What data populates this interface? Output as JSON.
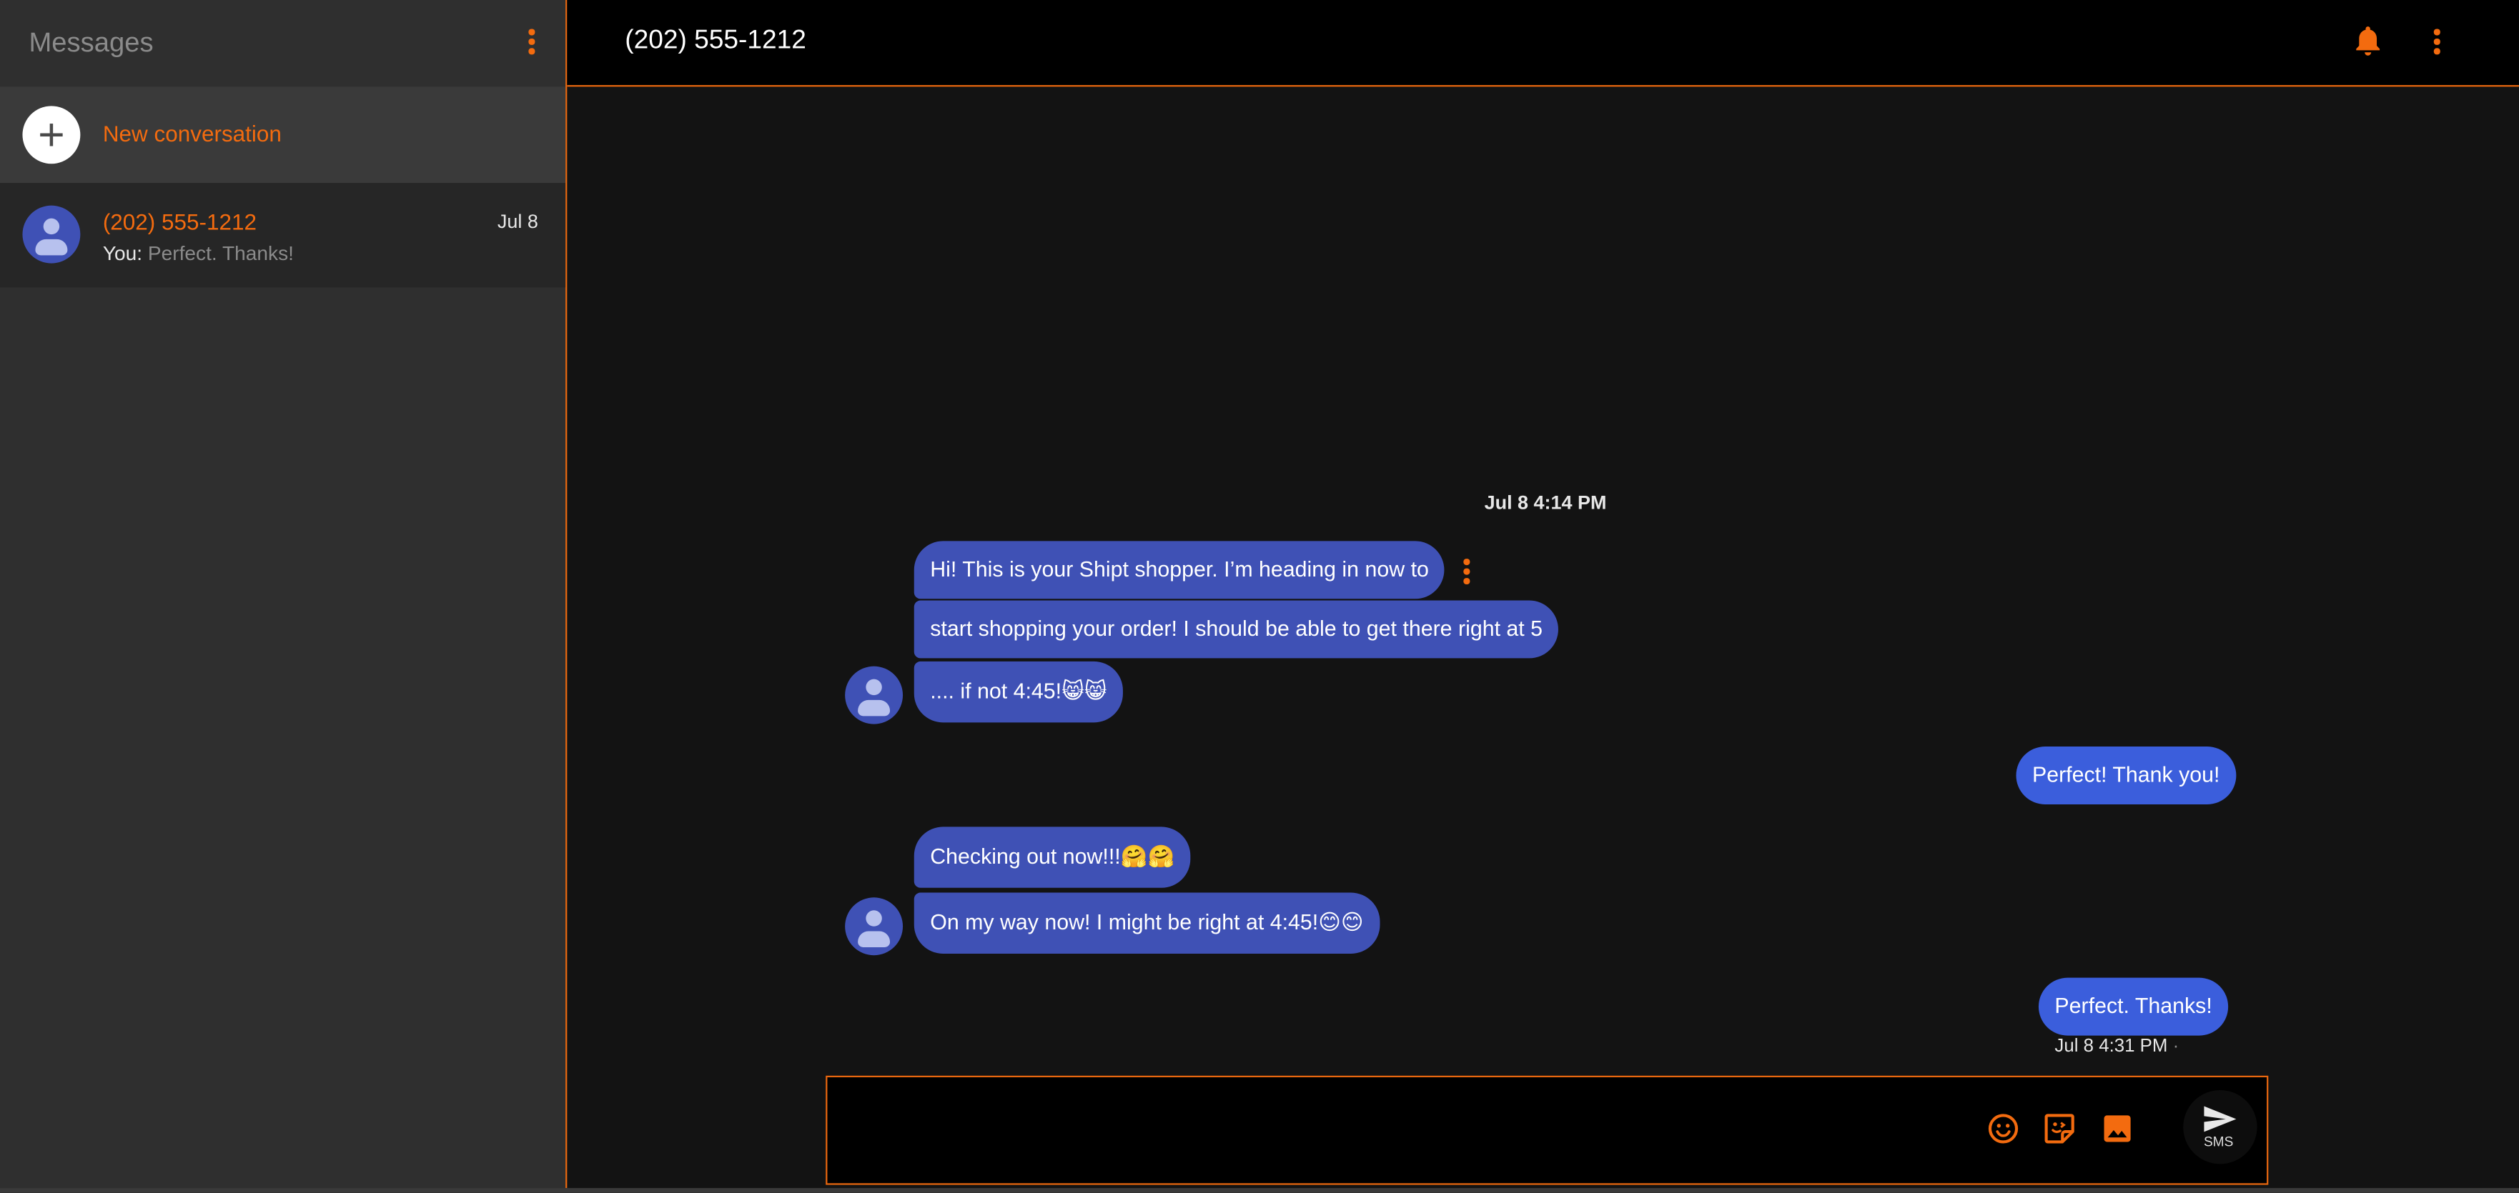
{
  "sidebar": {
    "title": "Messages",
    "menu_icon": "more-vert-icon",
    "new_conversation_label": "New conversation",
    "conversations": [
      {
        "name": "(202) 555-1212",
        "date": "Jul 8",
        "snippet_prefix": "You:",
        "snippet": "Perfect. Thanks!"
      }
    ]
  },
  "header": {
    "title": "(202) 555-1212",
    "notification_icon": "bell-icon",
    "menu_icon": "more-vert-icon"
  },
  "thread": {
    "timestamp": "Jul 8 4:14 PM",
    "messages": [
      {
        "direction": "incoming",
        "text": "Hi! This is your Shipt shopper. I’m heading in now to"
      },
      {
        "direction": "incoming",
        "text": "start shopping your order! I should be able to get there right at 5"
      },
      {
        "direction": "incoming",
        "text": ".... if not 4:45!😸😸"
      },
      {
        "direction": "outgoing",
        "text": "Perfect!  Thank you!"
      },
      {
        "direction": "incoming",
        "text": "Checking out now!!!🤗🤗"
      },
      {
        "direction": "incoming",
        "text": "On my way now! I might be right at 4:45!😊😊"
      },
      {
        "direction": "outgoing",
        "text": "Perfect.   Thanks!"
      }
    ],
    "last_sent_time": "Jul 8 4:31 PM",
    "last_sent_separator": "·"
  },
  "composer": {
    "placeholder": "",
    "emoji_icon": "emoji-icon",
    "sticker_icon": "sticker-icon",
    "image_icon": "image-icon",
    "send_label": "SMS"
  },
  "colors": {
    "accent": "#f36b0f",
    "incoming_bubble": "#3f51b5",
    "outgoing_bubble": "#3b5edc",
    "sidebar_bg": "#2f2f2f",
    "thread_bg": "#131313"
  }
}
